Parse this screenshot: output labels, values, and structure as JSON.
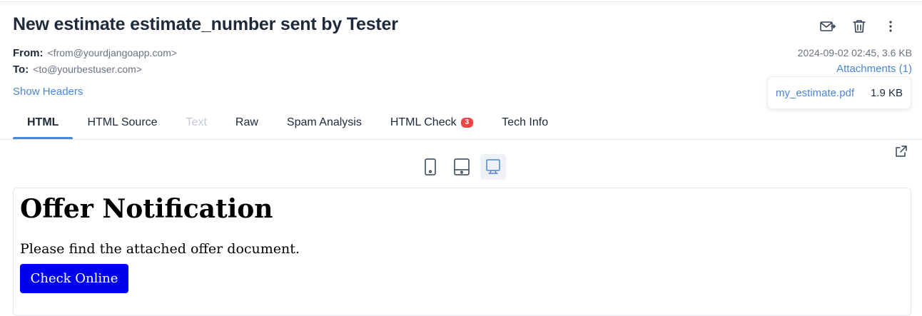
{
  "email": {
    "subject": "New estimate estimate_number sent by Tester",
    "from_label": "From:",
    "from_value": "<from@yourdjangoapp.com>",
    "to_label": "To:",
    "to_value": "<to@yourbestuser.com>",
    "date_size": "2024-09-02 02:45, 3.6 KB",
    "attachments_link": "Attachments (1)",
    "show_headers": "Show Headers"
  },
  "attachments": [
    {
      "name": "my_estimate.pdf",
      "size": "1.9 KB"
    }
  ],
  "actions": {
    "icons": [
      "forward-icon",
      "trash-icon",
      "more-vertical-icon"
    ]
  },
  "tabs": [
    {
      "label": "HTML",
      "state": "active"
    },
    {
      "label": "HTML Source",
      "state": "normal"
    },
    {
      "label": "Text",
      "state": "disabled"
    },
    {
      "label": "Raw",
      "state": "normal"
    },
    {
      "label": "Spam Analysis",
      "state": "normal"
    },
    {
      "label": "HTML Check",
      "state": "normal",
      "badge": "3"
    },
    {
      "label": "Tech Info",
      "state": "normal"
    }
  ],
  "device_toggle": {
    "options": [
      "mobile-icon",
      "tablet-icon",
      "desktop-icon"
    ],
    "selected": "desktop-icon"
  },
  "preview": {
    "heading": "Offer Notification",
    "paragraph": "Please find the attached offer document.",
    "button": "Check Online"
  },
  "colors": {
    "accent": "#4a86d8",
    "badge": "#ef4444",
    "preview_button": "#0000ee",
    "text_dark": "#1e293b",
    "text_muted": "#6b7280"
  }
}
